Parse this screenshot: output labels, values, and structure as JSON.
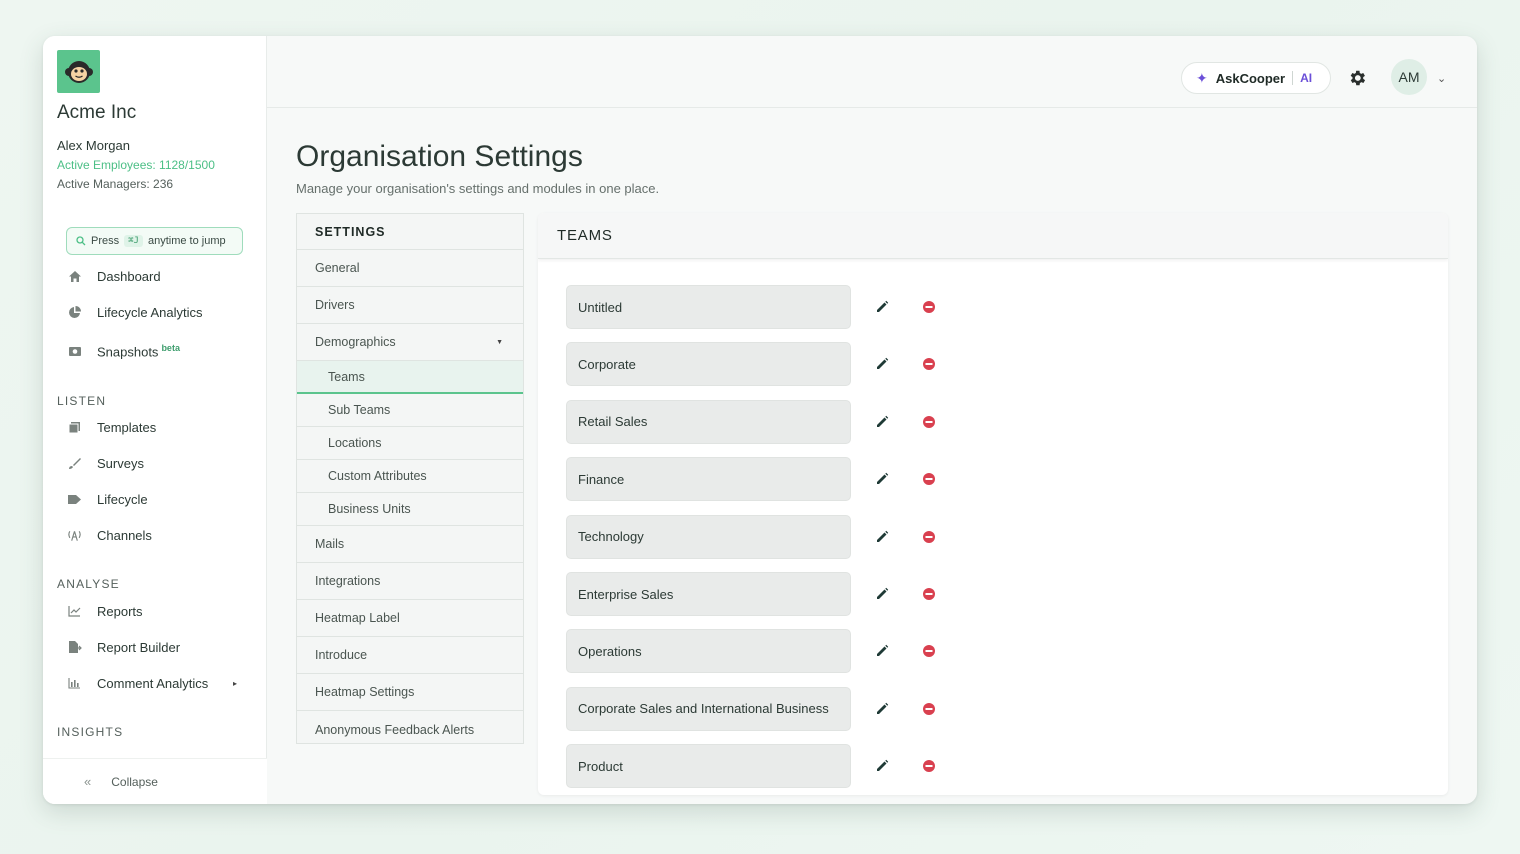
{
  "org": {
    "name": "Acme Inc",
    "user": "Alex Morgan",
    "active_employees": "Active Employees: 1128/1500",
    "active_managers": "Active Managers: 236"
  },
  "jump": {
    "prefix": "Press",
    "shortcut": "⌘J",
    "suffix": "anytime to jump"
  },
  "nav": {
    "dashboard": "Dashboard",
    "lifecycle_analytics": "Lifecycle Analytics",
    "snapshots": "Snapshots",
    "snapshots_badge": "beta",
    "listen_label": "LISTEN",
    "templates": "Templates",
    "surveys": "Surveys",
    "lifecycle": "Lifecycle",
    "channels": "Channels",
    "analyse_label": "ANALYSE",
    "reports": "Reports",
    "report_builder": "Report Builder",
    "comment_analytics": "Comment Analytics",
    "insights_label": "INSIGHTS",
    "collapse": "Collapse"
  },
  "topbar": {
    "askcooper": "AskCooper",
    "ai_badge": "AI",
    "avatar_initials": "AM"
  },
  "page": {
    "title": "Organisation Settings",
    "subtitle": "Manage your organisation's settings and modules in one place."
  },
  "settings_menu": {
    "header": "SETTINGS",
    "general": "General",
    "drivers": "Drivers",
    "demographics": "Demographics",
    "teams": "Teams",
    "sub_teams": "Sub Teams",
    "locations": "Locations",
    "custom_attributes": "Custom Attributes",
    "business_units": "Business Units",
    "mails": "Mails",
    "integrations": "Integrations",
    "heatmap_label": "Heatmap Label",
    "introduce": "Introduce",
    "heatmap_settings": "Heatmap Settings",
    "anonymous_feedback_alerts": "Anonymous Feedback Alerts"
  },
  "teams_panel": {
    "header": "TEAMS",
    "teams": [
      "Untitled",
      "Corporate",
      "Retail Sales",
      "Finance",
      "Technology",
      "Enterprise Sales",
      "Operations",
      "Corporate Sales and International Business",
      "Product"
    ]
  },
  "colors": {
    "brand_green": "#5bc48d",
    "accent_purple": "#6b4fd8",
    "delete_red": "#d9404f",
    "edit_dark": "#1f3a36"
  }
}
